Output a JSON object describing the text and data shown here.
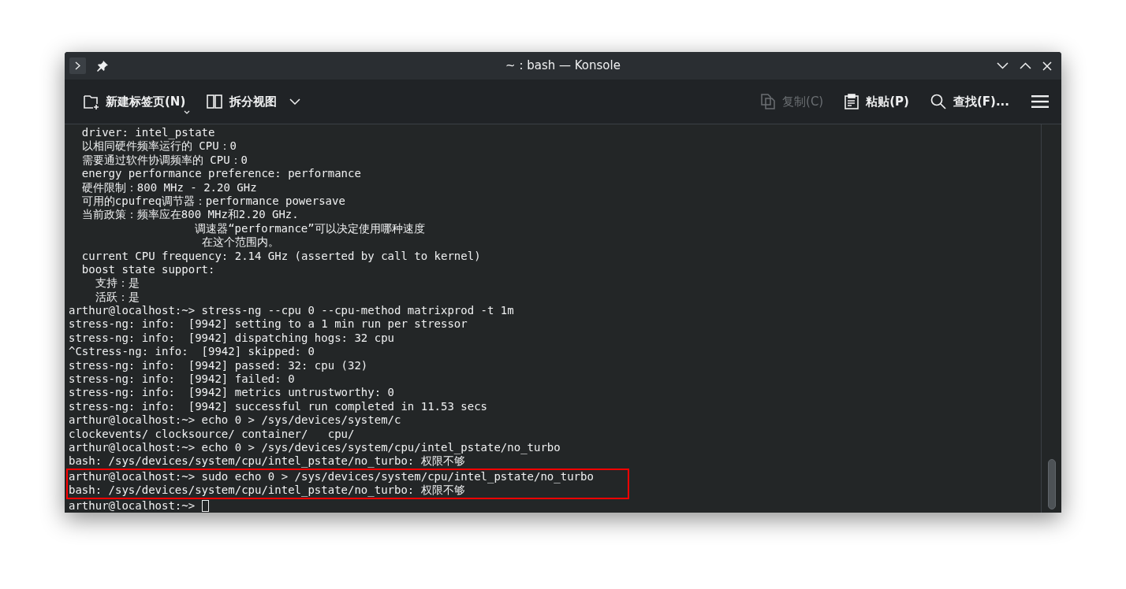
{
  "window": {
    "title": "~ : bash — Konsole"
  },
  "toolbar": {
    "left": [
      {
        "kind": "new-tab",
        "label": "新建标签页(N)",
        "disabled": false
      },
      {
        "kind": "split",
        "label": "拆分视图",
        "disabled": false
      }
    ],
    "right": [
      {
        "kind": "copy",
        "label": "复制(C)",
        "disabled": true
      },
      {
        "kind": "paste",
        "label": "粘贴(P)",
        "disabled": false
      },
      {
        "kind": "find",
        "label": "查找(F)...",
        "disabled": false
      }
    ]
  },
  "terminal": {
    "lines": [
      "  driver: intel_pstate",
      "  以相同硬件频率运行的 CPU：0",
      "  需要通过软件协调频率的 CPU：0",
      "  energy performance preference: performance",
      "  硬件限制：800 MHz - 2.20 GHz",
      "  可用的cpufreq调节器：performance powersave",
      "  当前政策：频率应在800 MHz和2.20 GHz.",
      "                   调速器“performance”可以决定使用哪种速度",
      "                    在这个范围内。",
      "  current CPU frequency: 2.14 GHz (asserted by call to kernel)",
      "  boost state support:",
      "    支持：是",
      "    活跃：是",
      "arthur@localhost:~> stress-ng --cpu 0 --cpu-method matrixprod -t 1m",
      "stress-ng: info:  [9942] setting to a 1 min run per stressor",
      "stress-ng: info:  [9942] dispatching hogs: 32 cpu",
      "^Cstress-ng: info:  [9942] skipped: 0",
      "stress-ng: info:  [9942] passed: 32: cpu (32)",
      "stress-ng: info:  [9942] failed: 0",
      "stress-ng: info:  [9942] metrics untrustworthy: 0",
      "stress-ng: info:  [9942] successful run completed in 11.53 secs",
      "arthur@localhost:~> echo 0 > /sys/devices/system/c",
      "clockevents/ clocksource/ container/   cpu/",
      "arthur@localhost:~> echo 0 > /sys/devices/system/cpu/intel_pstate/no_turbo",
      "bash: /sys/devices/system/cpu/intel_pstate/no_turbo: 权限不够"
    ],
    "highlighted_lines": [
      "arthur@localhost:~> sudo echo 0 > /sys/devices/system/cpu/intel_pstate/no_turbo",
      "bash: /sys/devices/system/cpu/intel_pstate/no_turbo: 权限不够"
    ],
    "prompt": "arthur@localhost:~> "
  }
}
